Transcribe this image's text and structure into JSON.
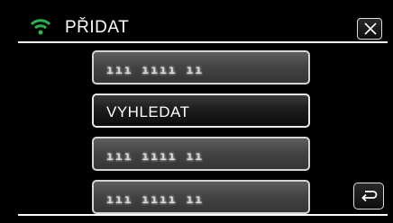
{
  "header": {
    "title": "PŘIDAT",
    "wifi_icon": "wifi-icon",
    "close_icon": "close-icon"
  },
  "list": {
    "items": [
      {
        "label": "ııı ıııı ıı",
        "obscured": true
      },
      {
        "label": "VYHLEDAT",
        "obscured": false
      },
      {
        "label": "ııı ıııı ıı",
        "obscured": true
      },
      {
        "label": "ııı ıııı ıı",
        "obscured": true
      }
    ]
  },
  "footer": {
    "back_icon": "return-icon"
  },
  "colors": {
    "background": "#000000",
    "wifi": "#2bb24c",
    "button_border": "#d4d4d4"
  }
}
